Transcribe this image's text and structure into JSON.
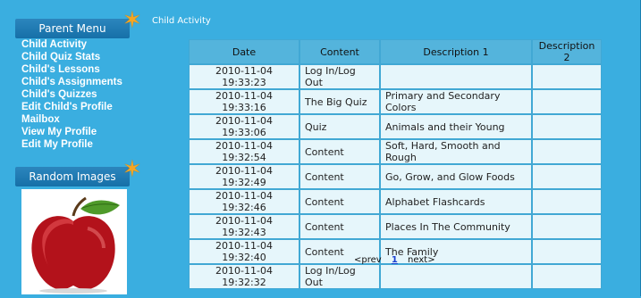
{
  "sidebar": {
    "parent_menu_title": "Parent Menu",
    "items": [
      {
        "label": "Child Activity"
      },
      {
        "label": "Child Quiz Stats"
      },
      {
        "label": "Child's Lessons"
      },
      {
        "label": "Child's Assignments"
      },
      {
        "label": "Child's Quizzes"
      },
      {
        "label": "Edit Child's Profile"
      },
      {
        "label": "Mailbox"
      },
      {
        "label": "View My Profile"
      },
      {
        "label": "Edit My Profile"
      }
    ],
    "random_images_title": "Random Images"
  },
  "breadcrumb": "Child Activity",
  "table": {
    "headers": [
      "Date",
      "Content",
      "Description 1",
      "Description 2"
    ],
    "rows": [
      [
        "2010-11-04 19:33:23",
        "Log In/Log Out",
        "",
        ""
      ],
      [
        "2010-11-04 19:33:16",
        "The Big Quiz",
        "Primary and Secondary Colors",
        ""
      ],
      [
        "2010-11-04 19:33:06",
        "Quiz",
        "Animals and their Young",
        ""
      ],
      [
        "2010-11-04 19:32:54",
        "Content",
        "Soft, Hard, Smooth and Rough",
        ""
      ],
      [
        "2010-11-04 19:32:49",
        "Content",
        "Go, Grow, and Glow Foods",
        ""
      ],
      [
        "2010-11-04 19:32:46",
        "Content",
        "Alphabet Flashcards",
        ""
      ],
      [
        "2010-11-04 19:32:43",
        "Content",
        "Places In The Community",
        ""
      ],
      [
        "2010-11-04 19:32:40",
        "Content",
        "The Family",
        ""
      ],
      [
        "2010-11-04 19:32:32",
        "Log In/Log Out",
        "",
        ""
      ]
    ]
  },
  "pager": {
    "prev": "<prev",
    "current": "1",
    "next": "next>"
  },
  "colors": {
    "background": "#3aaee0",
    "header": "#54b4dc",
    "cell": "#e6f6fb",
    "accent_star": "#f5a623"
  }
}
